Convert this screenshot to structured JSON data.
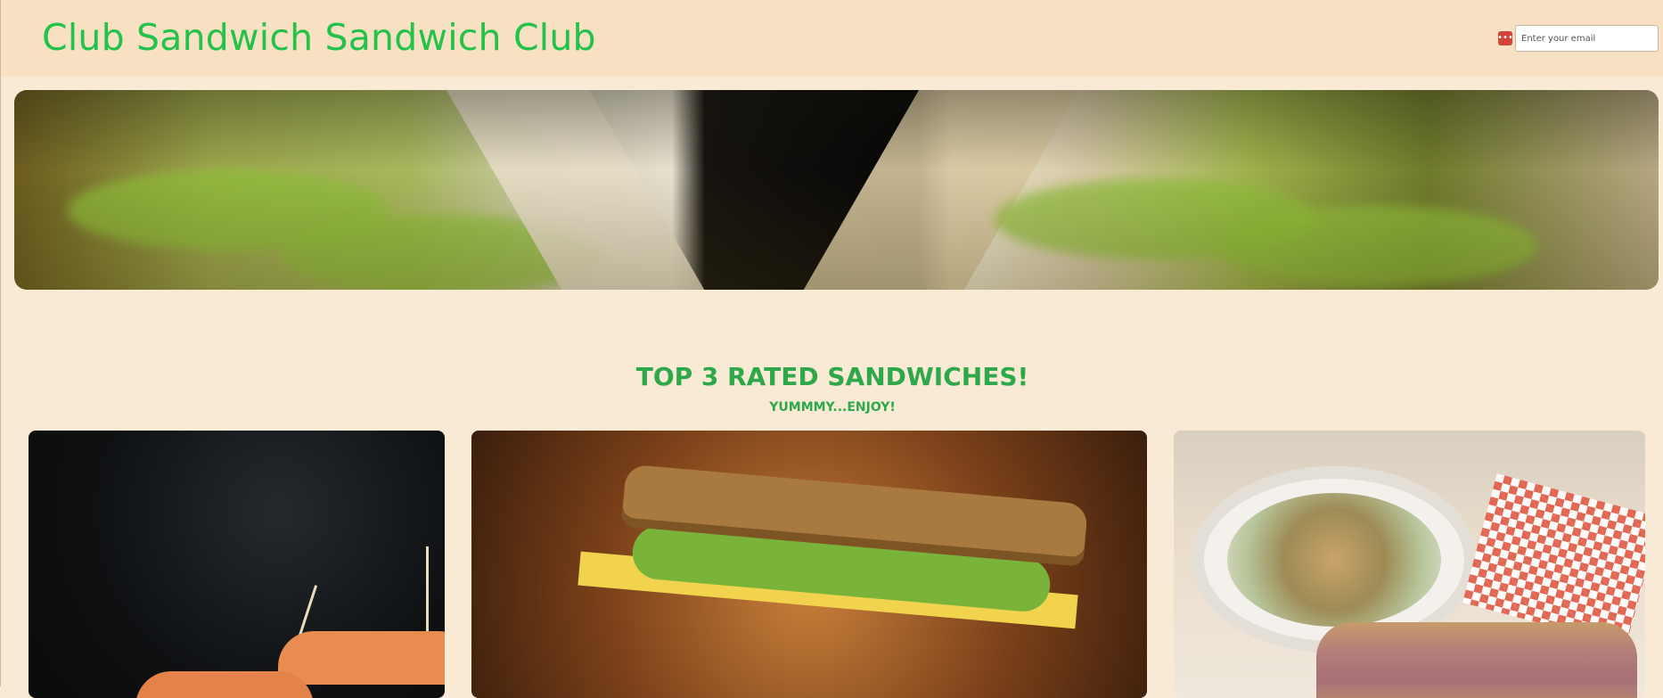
{
  "header": {
    "title": "Club Sandwich Sandwich Club",
    "email_placeholder": "Enter your email",
    "password_manager_icon": "dots-icon"
  },
  "hero": {
    "image_alt": "Close-up of a club sandwich cut in half"
  },
  "section": {
    "title": "TOP 3 RATED SANDWICHES!",
    "subtitle": "YUMMMY...ENJOY!"
  },
  "cards": [
    {
      "image_alt": "Sandwiches with toothpick skewers on dark background"
    },
    {
      "image_alt": "Whole wheat sandwich with lettuce, cheese and turkey"
    },
    {
      "image_alt": "Sandwich with salad bowl and checkered paper"
    }
  ],
  "colors": {
    "page_bg": "#f9ead5",
    "header_bg": "#f8e0c2",
    "title_green": "#22c24b",
    "section_green": "#2ea84a"
  }
}
